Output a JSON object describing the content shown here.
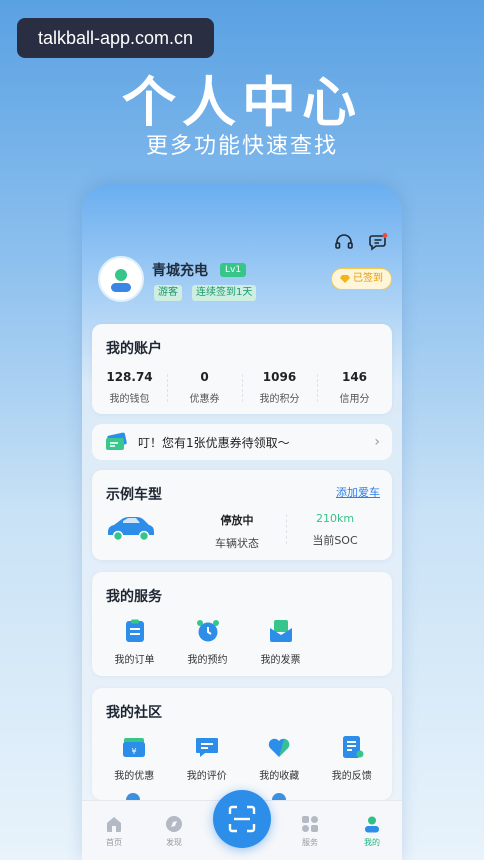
{
  "watermark": "talkball-app.com.cn",
  "hero": {
    "title": "个人中心",
    "subtitle": "更多功能快速查找"
  },
  "profile": {
    "name": "青城充电",
    "level": "Lv1",
    "tags": [
      "游客",
      "连续签到1天"
    ],
    "signin_label": "已签到"
  },
  "account": {
    "title": "我的账户",
    "stats": [
      {
        "value": "128.74",
        "label": "我的钱包"
      },
      {
        "value": "0",
        "label": "优惠券"
      },
      {
        "value": "1096",
        "label": "我的积分"
      },
      {
        "value": "146",
        "label": "信用分"
      }
    ]
  },
  "coupon_notice": "叮！您有1张优惠券待领取～",
  "car": {
    "title": "示例车型",
    "add_label": "添加爱车",
    "status_value": "停放中",
    "status_label": "车辆状态",
    "soc_value": "210km",
    "soc_label": "当前SOC"
  },
  "services": {
    "title": "我的服务",
    "items": [
      {
        "label": "我的订单",
        "icon": "order-icon"
      },
      {
        "label": "我的预约",
        "icon": "alarm-clock-icon"
      },
      {
        "label": "我的发票",
        "icon": "invoice-icon"
      }
    ]
  },
  "community": {
    "title": "我的社区",
    "items": [
      {
        "label": "我的优惠",
        "icon": "coupon-icon"
      },
      {
        "label": "我的评价",
        "icon": "comment-icon"
      },
      {
        "label": "我的收藏",
        "icon": "heart-icon"
      },
      {
        "label": "我的反馈",
        "icon": "feedback-icon"
      }
    ]
  },
  "tabbar": [
    {
      "label": "首页",
      "icon": "home-icon"
    },
    {
      "label": "发现",
      "icon": "compass-icon"
    },
    {
      "label": "",
      "icon": "scan-icon"
    },
    {
      "label": "服务",
      "icon": "grid-icon"
    },
    {
      "label": "我的",
      "icon": "user-icon"
    }
  ],
  "colors": {
    "accent": "#2d8ee9",
    "green": "#33c48a",
    "gold": "#f5c94e"
  }
}
